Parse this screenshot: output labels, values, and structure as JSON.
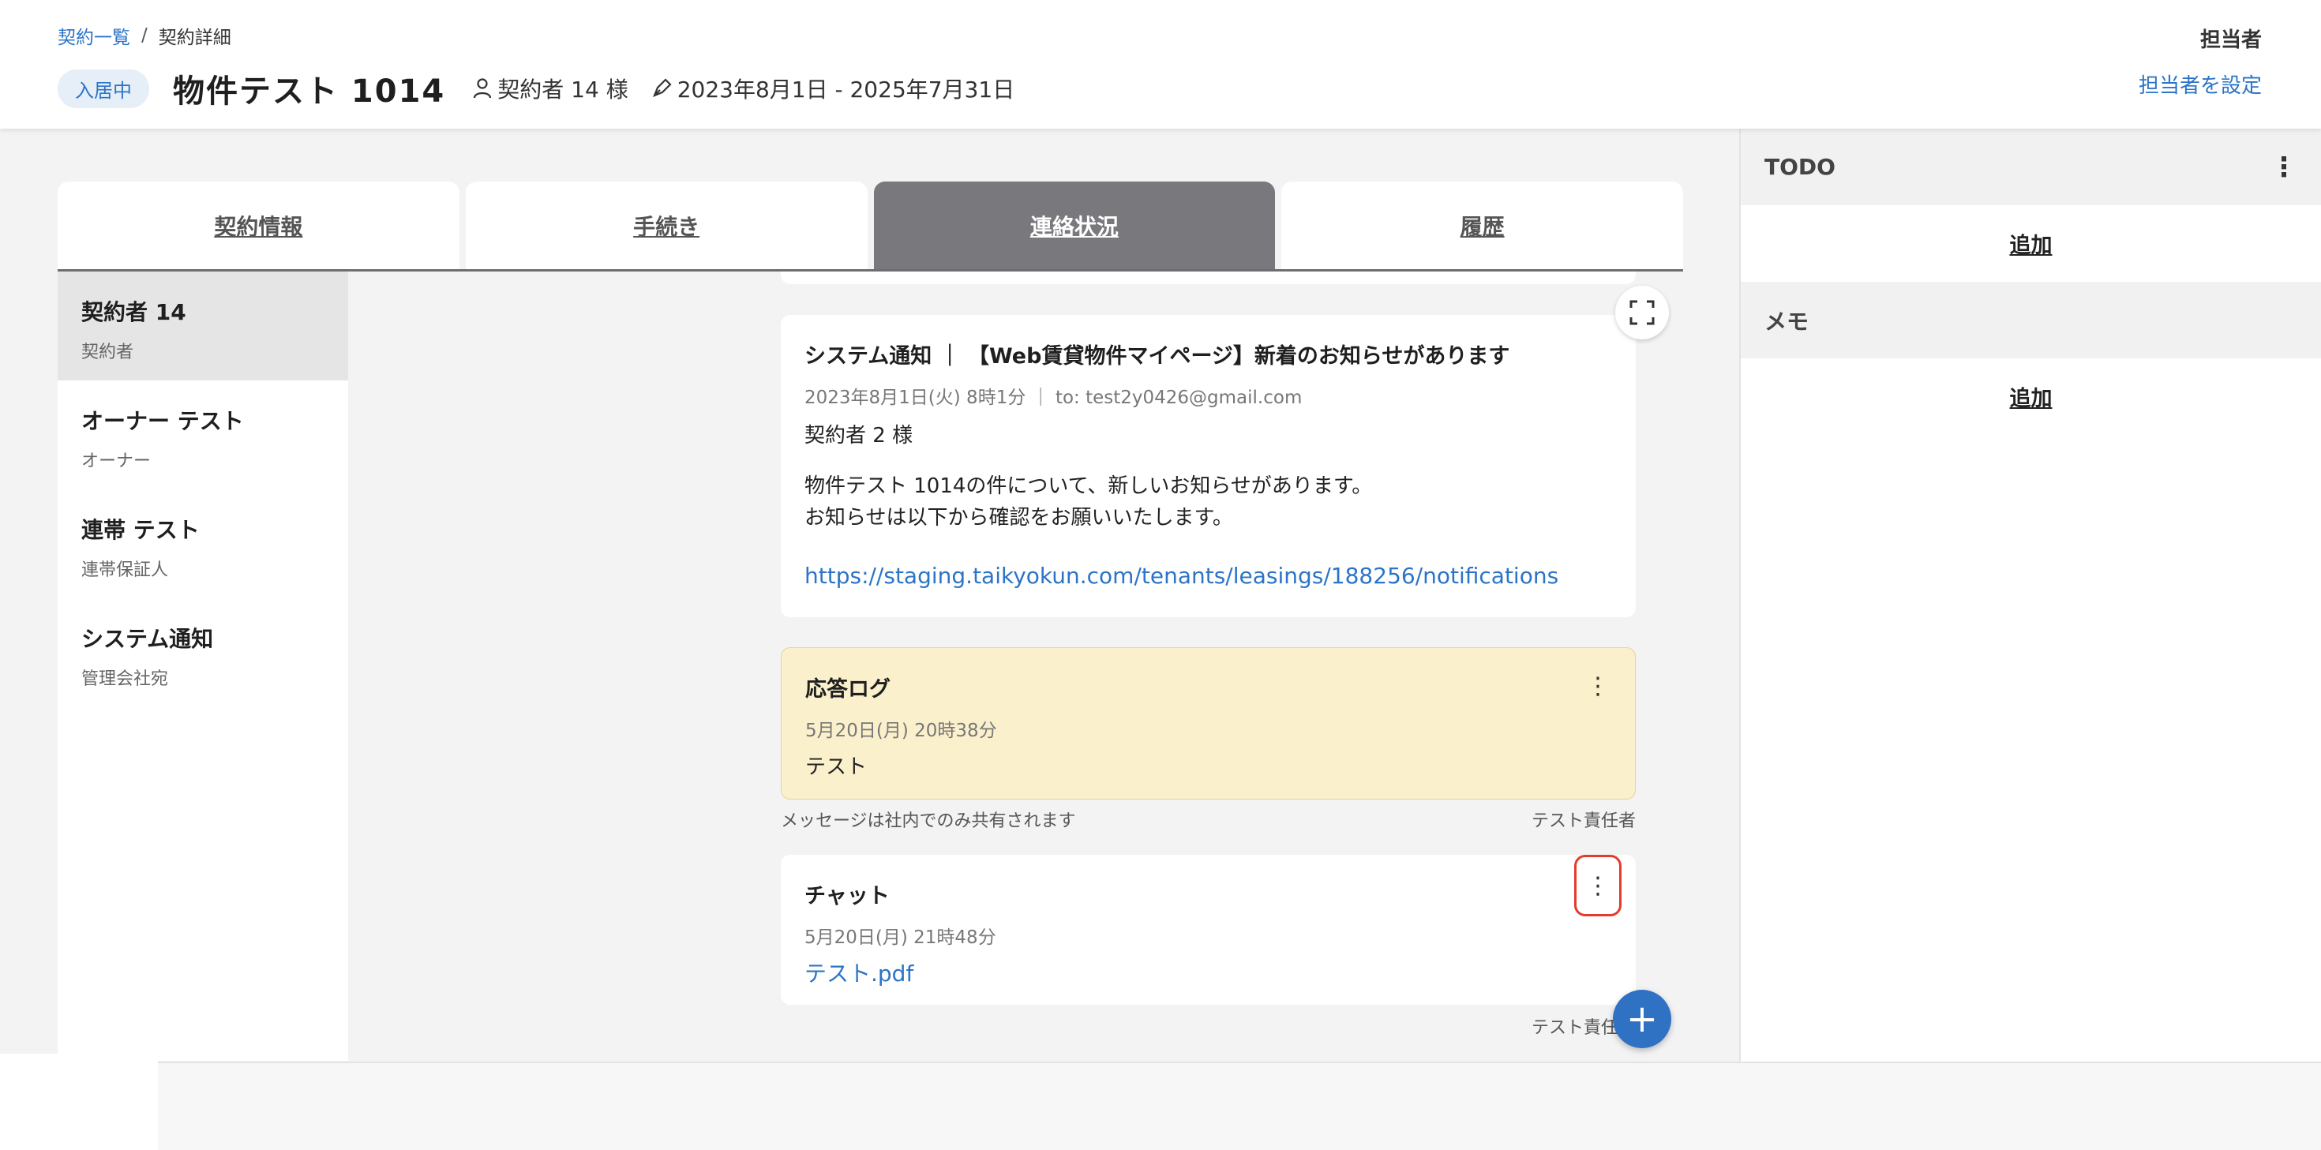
{
  "breadcrumb": {
    "list_link": "契約一覧",
    "separator": "/",
    "current": "契約詳細"
  },
  "header": {
    "status_badge": "入居中",
    "property_title": "物件テスト 1014",
    "contractor": "契約者 14 様",
    "period": "2023年8月1日 - 2025年7月31日",
    "assignee_label": "担当者",
    "assignee_link": "担当者を設定"
  },
  "tabs": [
    {
      "label": "契約情報",
      "active": false
    },
    {
      "label": "手続き",
      "active": false
    },
    {
      "label": "連絡状況",
      "active": true
    },
    {
      "label": "履歴",
      "active": false
    }
  ],
  "contacts": [
    {
      "name": "契約者 14",
      "role": "契約者",
      "active": true
    },
    {
      "name": "オーナー テスト",
      "role": "オーナー",
      "active": false
    },
    {
      "name": "連帯 テスト",
      "role": "連帯保証人",
      "active": false
    },
    {
      "name": "システム通知",
      "role": "管理会社宛",
      "active": false
    }
  ],
  "feed": {
    "system_notice": {
      "title": "システム通知 ｜ 【Web賃貸物件マイページ】新着のお知らせがあります",
      "date": "2023年8月1日(火) 8時1分 ｜ to: test2y0426@gmail.com",
      "greeting": "契約者 2 様",
      "line1": "物件テスト 1014の件について、新しいお知らせがあります。",
      "line2": "お知らせは以下から確認をお願いいたします。",
      "link": "https://staging.taikyokun.com/tenants/leasings/188256/notifications"
    },
    "response_log": {
      "title": "応答ログ",
      "date": "5月20日(月) 20時38分",
      "body": "テスト",
      "note_left": "メッセージは社内でのみ共有されます",
      "note_right": "テスト責任者"
    },
    "chat": {
      "title": "チャット",
      "date": "5月20日(月) 21時48分",
      "attachment": "テスト.pdf",
      "note_right": "テスト責任者"
    }
  },
  "right_panel": {
    "todo_title": "TODO",
    "todo_add": "追加",
    "memo_title": "メモ",
    "memo_add": "追加"
  },
  "icons": {
    "more": "⋮",
    "plus": "+"
  },
  "colors": {
    "accent": "#2b74c7",
    "active_tab": "#78787d",
    "log_background": "#fbf0cc",
    "highlight": "#e53b2c",
    "fab": "#2f72c4"
  }
}
